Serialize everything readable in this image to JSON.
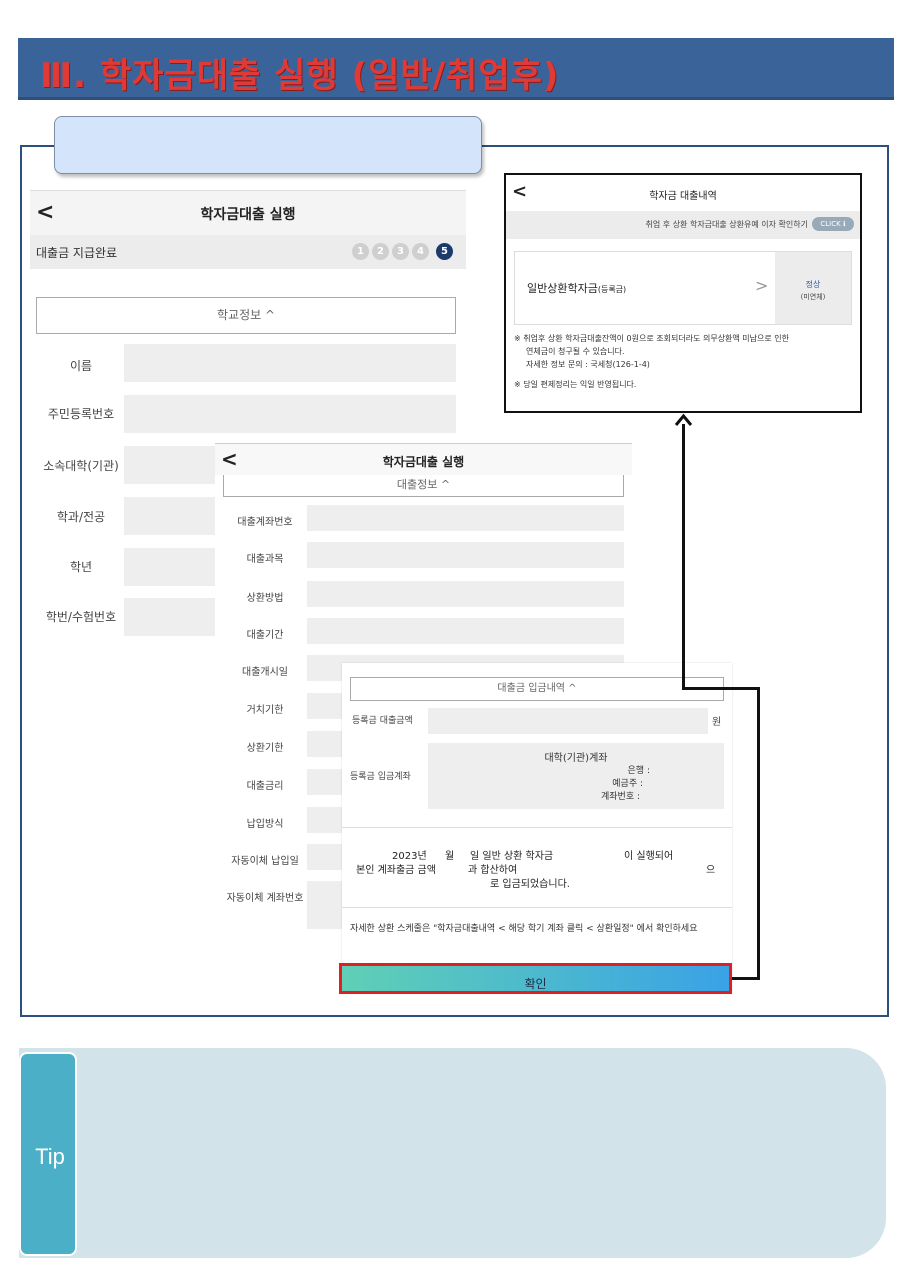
{
  "page_title": "Ⅲ. 학자금대출 실행 (일반/취업후)",
  "screen1": {
    "title": "학자금대출 실행",
    "status": "대출금 지급완료",
    "steps": [
      "1",
      "2",
      "3",
      "4",
      "5"
    ],
    "section": "학교정보 ^",
    "fields": [
      "이름",
      "주민등록번호",
      "소속대학(기관)",
      "학과/전공",
      "학년",
      "학번/수험번호"
    ]
  },
  "screen2": {
    "title": "학자금대출 실행",
    "section": "대출정보 ^",
    "fields": [
      "대출계좌번호",
      "대출과목",
      "상환방법",
      "대출기간",
      "대출개시일",
      "거치기한",
      "상환기한",
      "대출금리",
      "납입방식",
      "자동이체 납입일",
      "자동이체 계좌번호"
    ]
  },
  "screen3": {
    "section": "대출금 입금내역 ^",
    "tuition_amount_label": "등록금 대출금액",
    "tuition_amount_unit": "원",
    "deposit_label": "등록금 입금계좌",
    "deposit_title": "대학(기관)계좌",
    "deposit_bank": "은행 :",
    "deposit_holder": "예금주 :",
    "deposit_account": "계좌번호 :",
    "msg_line1a": "2023년",
    "msg_line1b": "월",
    "msg_line1c": "일 일반 상환 학자금",
    "msg_line1d": "이 실행되어",
    "msg_line2a": "본인 계좌출금 금액",
    "msg_line2b": "과 합산하여",
    "msg_line2c": "으",
    "msg_line3": "로 입금되었습니다.",
    "footer": "자세한 상환 스케줄은 \"학자금대출내역 < 해당 학기 계좌 클릭 < 상환일정\" 에서 확인하세요",
    "confirm": "확인"
  },
  "screen4": {
    "title": "학자금 대출내역",
    "notice": "취업 후 상환 학자금대출 상환유예 이자 확인하기",
    "click_badge": "CLICK ℹ",
    "loan_name": "일반상환학자금",
    "loan_sub": "(등록금)",
    "status": "정상",
    "status_sub": "(미연체)",
    "note1": "※ 취업후 상환 학자금대출잔액이 0원으로 조회되더라도 의무상환액 미납으로 인한",
    "note1b": "연체금이 청구될 수 있습니다.",
    "note1c": "자세한 정보 문의 : 국세청(126-1-4)",
    "note2": "※ 당일 편제정리는 익일 반영됩니다."
  },
  "tip": {
    "label": "Tip"
  },
  "colors": {
    "title_bar": "#3a6499",
    "title_text": "#e03a36",
    "confirm_border": "#e02020",
    "tip_label": "#4bafc8",
    "tip_bg": "#d3e3ea"
  }
}
